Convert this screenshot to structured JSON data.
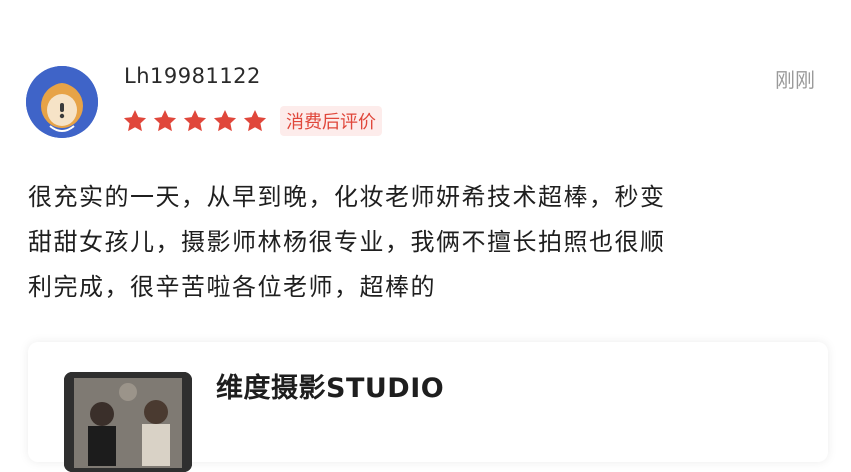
{
  "review": {
    "username": "Lh19981122",
    "time": "刚刚",
    "rating": 5,
    "rating_max": 5,
    "tag": "消费后评价",
    "text_lines": [
      "很充实的一天，从早到晚，化妆老师妍希技术超棒，秒变",
      "甜甜女孩儿，摄影师林杨很专业，我俩不擅长拍照也很顺",
      "利完成，很辛苦啦各位老师，超棒的"
    ]
  },
  "shop": {
    "name": "维度摄影STUDIO"
  },
  "colors": {
    "avatar_bg": "#3f64c8",
    "star": "#e0473b",
    "tag_text": "#e0473b",
    "time_text": "#9a9a9a"
  },
  "icons": {
    "avatar": "cartoon-avatar-icon",
    "star": "star-icon"
  }
}
